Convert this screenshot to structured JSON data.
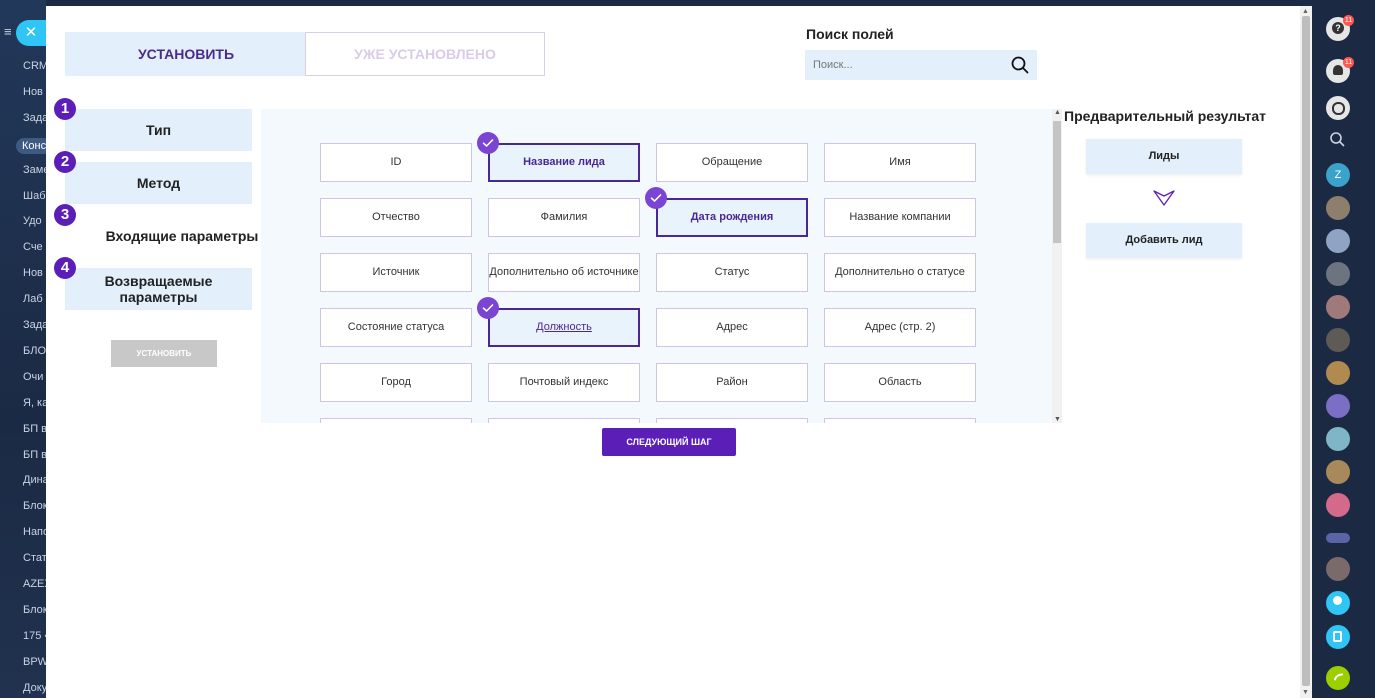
{
  "left_nav": {
    "items": [
      "CRM",
      "Нов",
      "Зада",
      "Конс",
      "Заме",
      "Шаб",
      "Удо",
      "Сче",
      "Нов",
      "Лаб",
      "Зада",
      "БЛО",
      "Очи",
      "Я, ка",
      "БП в",
      "БП в",
      "Дина",
      "Блок",
      "Напо",
      "Стат",
      "AZEX",
      "Блок",
      "175 «",
      "BPW",
      "Доку"
    ],
    "active_index": 3
  },
  "tabs": {
    "install_label": "УСТАНОВИТЬ",
    "installed_label": "УЖЕ УСТАНОВЛЕНО"
  },
  "search": {
    "title": "Поиск полей",
    "placeholder": "Поиск..."
  },
  "steps": [
    {
      "number": "1",
      "label": "Тип"
    },
    {
      "number": "2",
      "label": "Метод"
    },
    {
      "number": "3",
      "label": "Входящие параметры"
    },
    {
      "number": "4",
      "label": "Возвращаемые параметры"
    }
  ],
  "install_button": "УСТАНОВИТЬ",
  "fields": [
    {
      "label": "ID",
      "selected": false
    },
    {
      "label": "Название лида",
      "selected": true
    },
    {
      "label": "Обращение",
      "selected": false
    },
    {
      "label": "Имя",
      "selected": false
    },
    {
      "label": "Отчество",
      "selected": false
    },
    {
      "label": "Фамилия",
      "selected": false
    },
    {
      "label": "Дата рождения",
      "selected": true
    },
    {
      "label": "Название компании",
      "selected": false
    },
    {
      "label": "Источник",
      "selected": false
    },
    {
      "label": "Дополнительно об источнике",
      "selected": false
    },
    {
      "label": "Статус",
      "selected": false
    },
    {
      "label": "Дополнительно о статусе",
      "selected": false
    },
    {
      "label": "Состояние статуса",
      "selected": false
    },
    {
      "label": "Должность",
      "selected": true
    },
    {
      "label": "Адрес",
      "selected": false
    },
    {
      "label": "Адрес (стр. 2)",
      "selected": false
    },
    {
      "label": "Город",
      "selected": false
    },
    {
      "label": "Почтовый индекс",
      "selected": false
    },
    {
      "label": "Район",
      "selected": false
    },
    {
      "label": "Область",
      "selected": false
    },
    {
      "label": "",
      "selected": false
    },
    {
      "label": "",
      "selected": false
    },
    {
      "label": "",
      "selected": false
    },
    {
      "label": "",
      "selected": false
    }
  ],
  "next_button": "СЛЕДУЮЩИЙ ШАГ",
  "preview": {
    "title": "Предварительный результат",
    "entity": "Лиды",
    "action": "Добавить лид"
  },
  "right_bar": {
    "help_badge": "11",
    "notifications_badge": "11",
    "avatar_letter": "Z"
  },
  "colors": {
    "accent": "#5b1fb8",
    "selected_border": "#4a2893",
    "light_blue": "#e3f0fb",
    "check": "#7b45d3"
  }
}
